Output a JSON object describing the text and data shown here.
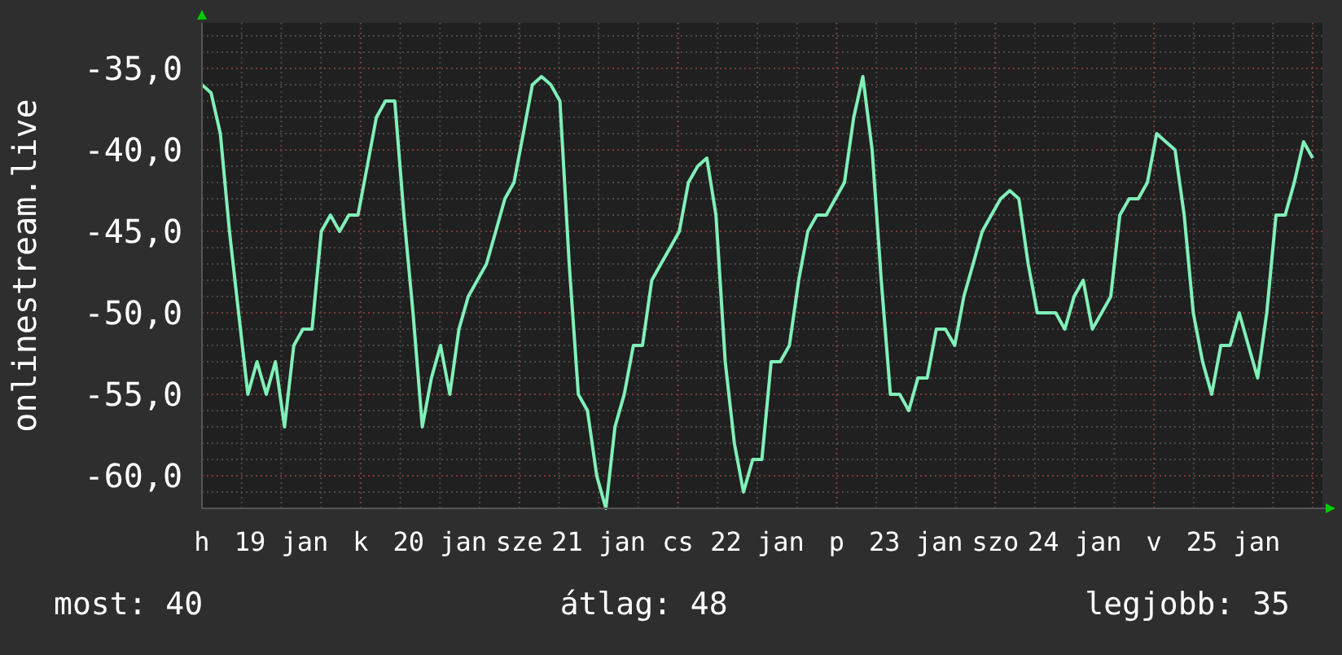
{
  "chart_data": {
    "type": "line",
    "ylabel": "onlinestream.live",
    "grid": true,
    "ylim": [
      -62,
      -32.2
    ],
    "yticks": [
      {
        "value": -35,
        "label": "-35,0"
      },
      {
        "value": -40,
        "label": "-40,0"
      },
      {
        "value": -45,
        "label": "-45,0"
      },
      {
        "value": -50,
        "label": "-50,0"
      },
      {
        "value": -55,
        "label": "-55,0"
      },
      {
        "value": -60,
        "label": "-60,0"
      }
    ],
    "series": [
      {
        "color": "#80f0b8",
        "values": [
          -36,
          -36.5,
          -39,
          -45,
          -50,
          -55,
          -53,
          -55,
          -53,
          -57,
          -52,
          -51,
          -51,
          -45,
          -44,
          -45,
          -44,
          -44,
          -41,
          -38,
          -37,
          -37,
          -44,
          -50,
          -57,
          -54,
          -52,
          -55,
          -51,
          -49,
          -48,
          -47,
          -45,
          -43,
          -42,
          -39,
          -36,
          -35.5,
          -36,
          -37,
          -47,
          -55,
          -56,
          -60,
          -62,
          -57,
          -55,
          -52,
          -52,
          -48,
          -47,
          -46,
          -45,
          -42,
          -41,
          -40.5,
          -44,
          -53,
          -58,
          -61,
          -59,
          -59,
          -53,
          -53,
          -52,
          -48,
          -45,
          -44,
          -44,
          -43,
          -42,
          -38,
          -35.5,
          -40,
          -48,
          -55,
          -55,
          -56,
          -54,
          -54,
          -51,
          -51,
          -52,
          -49,
          -47,
          -45,
          -44,
          -43,
          -42.5,
          -43,
          -47,
          -50,
          -50,
          -50,
          -51,
          -49,
          -48,
          -51,
          -50,
          -49,
          -44,
          -43,
          -43,
          -42,
          -39,
          -39.5,
          -40,
          -44,
          -50,
          -53,
          -55,
          -52,
          -52,
          -50,
          -52,
          -54,
          -50,
          -44,
          -44,
          -42,
          -39.5,
          -40.5
        ]
      }
    ]
  },
  "x_axis_labels": [
    "h",
    "19 jan",
    "k",
    "20 jan",
    "sze",
    "21 jan",
    "cs",
    "22 jan",
    "p",
    "23 jan",
    "szo",
    "24 jan",
    "v",
    "25 jan"
  ],
  "legend": [
    {
      "label": "most: 40"
    },
    {
      "label": "átlag: 48"
    },
    {
      "label": "legjobb: 35"
    }
  ]
}
